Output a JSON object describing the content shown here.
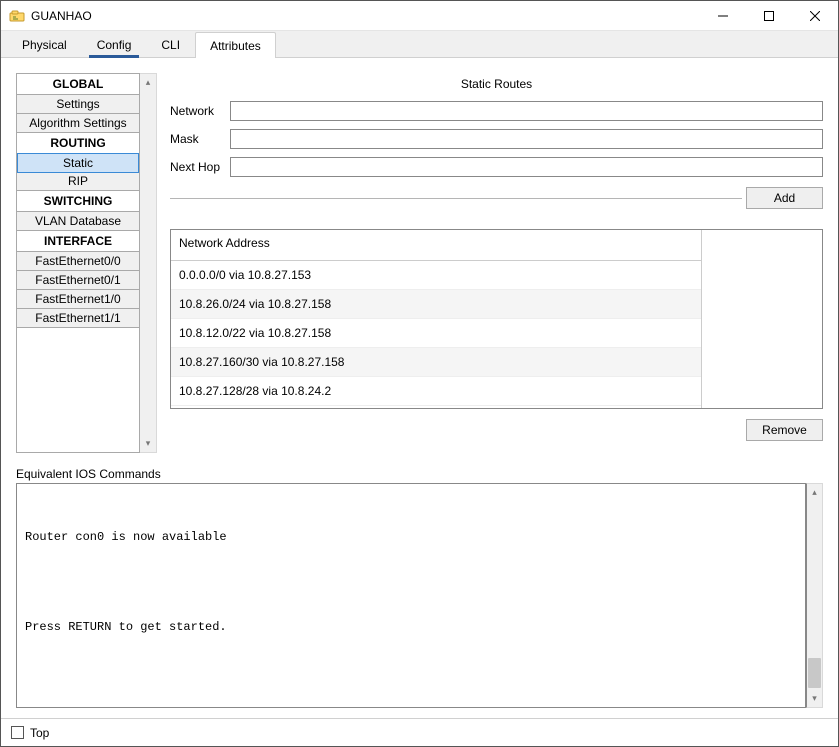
{
  "window": {
    "title": "GUANHAO"
  },
  "tabs": [
    "Physical",
    "Config",
    "CLI",
    "Attributes"
  ],
  "tabs_selected_underline_index": 1,
  "tabs_active_index": 3,
  "sidebar": {
    "groups": [
      {
        "header": "GLOBAL",
        "items": [
          "Settings",
          "Algorithm Settings"
        ]
      },
      {
        "header": "ROUTING",
        "items": [
          "Static",
          "RIP"
        ],
        "selected": "Static"
      },
      {
        "header": "SWITCHING",
        "items": [
          "VLAN Database"
        ]
      },
      {
        "header": "INTERFACE",
        "items": [
          "FastEthernet0/0",
          "FastEthernet0/1",
          "FastEthernet1/0",
          "FastEthernet1/1"
        ]
      }
    ]
  },
  "panel_title": "Static Routes",
  "form": {
    "network_label": "Network",
    "mask_label": "Mask",
    "next_hop_label": "Next Hop",
    "network_value": "",
    "mask_value": "",
    "next_hop_value": "",
    "add_button": "Add"
  },
  "routes": {
    "header": "Network Address",
    "rows": [
      "0.0.0.0/0 via 10.8.27.153",
      "10.8.26.0/24 via 10.8.27.158",
      "10.8.12.0/22 via 10.8.27.158",
      "10.8.27.160/30 via 10.8.27.158",
      "10.8.27.128/28 via 10.8.24.2"
    ],
    "remove_button": "Remove"
  },
  "ios_label": "Equivalent IOS Commands",
  "console_text": "\n\nRouter con0 is now available\n\n\n\n\nPress RETURN to get started.\n\n\n",
  "bottom": {
    "top_label": "Top"
  }
}
